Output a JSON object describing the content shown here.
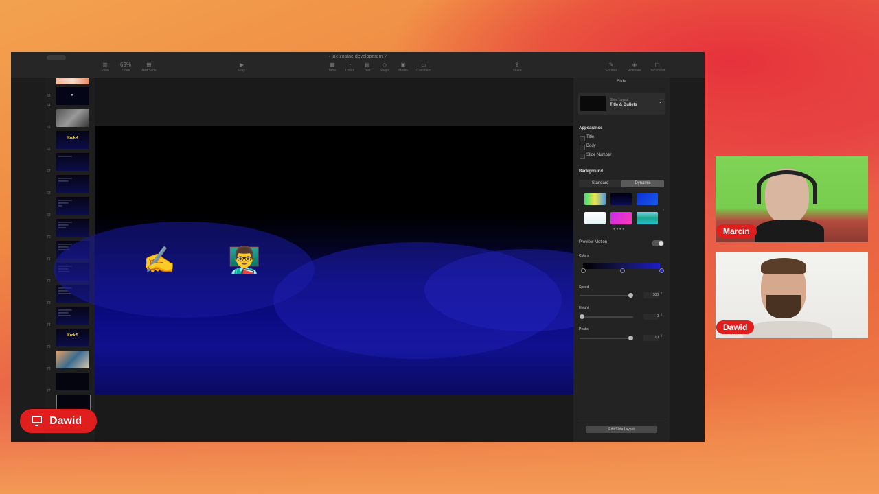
{
  "window": {
    "document_title": "jak-zostac-developerem"
  },
  "toolbar": {
    "left": [
      {
        "label": "View",
        "icon": "sidebar-icon"
      },
      {
        "label": "Zoom",
        "icon": "zoom-icon",
        "value": "69%"
      },
      {
        "label": "Add Slide",
        "icon": "plus-icon"
      }
    ],
    "center": [
      {
        "label": "Play",
        "icon": "play-icon"
      }
    ],
    "insert": [
      {
        "label": "Table",
        "icon": "table-icon"
      },
      {
        "label": "Chart",
        "icon": "chart-icon"
      },
      {
        "label": "Text",
        "icon": "text-icon"
      },
      {
        "label": "Shape",
        "icon": "shape-icon"
      },
      {
        "label": "Media",
        "icon": "media-icon"
      },
      {
        "label": "Comment",
        "icon": "comment-icon"
      }
    ],
    "share": {
      "label": "Share",
      "icon": "share-icon"
    },
    "right": [
      {
        "label": "Format",
        "icon": "brush-icon"
      },
      {
        "label": "Animate",
        "icon": "animate-icon"
      },
      {
        "label": "Document",
        "icon": "document-icon"
      }
    ]
  },
  "navigator": {
    "slides": [
      {
        "num": "63",
        "kind": "image",
        "text": ""
      },
      {
        "num": "64",
        "kind": "dark",
        "text": ""
      },
      {
        "num": "65",
        "kind": "image",
        "text": ""
      },
      {
        "num": "66",
        "kind": "title",
        "text": "Krok 4"
      },
      {
        "num": "67",
        "kind": "bullets",
        "text": ""
      },
      {
        "num": "68",
        "kind": "bullets",
        "text": ""
      },
      {
        "num": "69",
        "kind": "bullets",
        "text": ""
      },
      {
        "num": "70",
        "kind": "bullets",
        "text": ""
      },
      {
        "num": "71",
        "kind": "bullets",
        "text": ""
      },
      {
        "num": "72",
        "kind": "bullets",
        "text": ""
      },
      {
        "num": "73",
        "kind": "bullets",
        "text": ""
      },
      {
        "num": "74",
        "kind": "bullets",
        "text": ""
      },
      {
        "num": "75",
        "kind": "title",
        "text": "Krok 5"
      },
      {
        "num": "76",
        "kind": "image",
        "text": ""
      },
      {
        "num": "77",
        "kind": "dark",
        "text": ""
      },
      {
        "num": "78",
        "kind": "dark",
        "text": ""
      }
    ]
  },
  "slide": {
    "emojis": [
      {
        "char": "✍️",
        "name": "writing-hand-emoji"
      },
      {
        "char": "👨‍🏫",
        "name": "teacher-emoji"
      }
    ]
  },
  "inspector": {
    "title": "Slide",
    "layout": {
      "caption": "Slide Layout",
      "value": "Title & Bullets"
    },
    "appearance": {
      "heading": "Appearance",
      "options": [
        "Title",
        "Body",
        "Slide Number"
      ]
    },
    "background": {
      "heading": "Background",
      "tabs": [
        "Standard",
        "Dynamic"
      ],
      "swatches": [
        {
          "name": "rainbow",
          "color": "linear-gradient(90deg,#3ce07a,#f0e24a,#4a9af0)"
        },
        {
          "name": "dark-blue",
          "color": "linear-gradient(180deg,#000010,#0a0a50)"
        },
        {
          "name": "blue",
          "color": "linear-gradient(135deg,#0a2fd0,#1a5af0)"
        },
        {
          "name": "white",
          "color": "linear-gradient(180deg,#ffffff,#e6f2f5)"
        },
        {
          "name": "magenta",
          "color": "linear-gradient(135deg,#c82af0,#ff3ab0)"
        },
        {
          "name": "teal-wave",
          "color": "linear-gradient(180deg,#7ad0e0,#19a890,#25c0d0)"
        }
      ]
    },
    "preview_motion": {
      "label": "Preview Motion",
      "on": true
    },
    "colors": {
      "label": "Colors"
    },
    "speed": {
      "label": "Speed",
      "value": "100"
    },
    "height": {
      "label": "Height",
      "value": "0"
    },
    "peaks": {
      "label": "Peaks",
      "value": "10"
    },
    "edit_button": "Edit Slide Layout"
  },
  "participants": [
    {
      "name": "Marcin"
    },
    {
      "name": "Dawid"
    }
  ],
  "presenter": {
    "name": "Dawid"
  }
}
